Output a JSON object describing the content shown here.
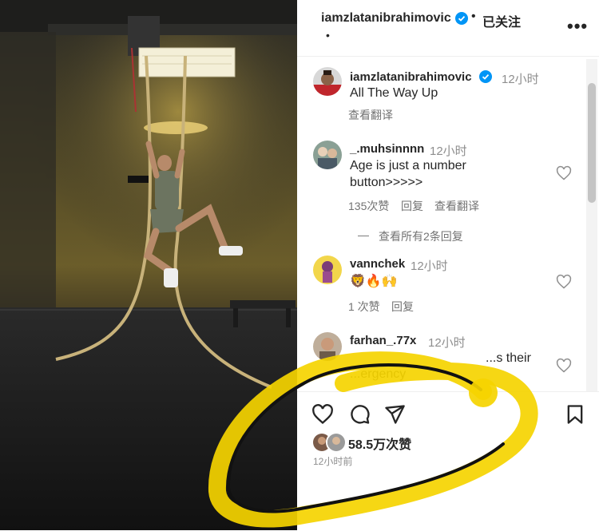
{
  "header": {
    "username": "iamzlatanibrahimovic",
    "separator": "•",
    "follow_status": "已关注",
    "sub_dot": "•",
    "more": "•••"
  },
  "caption": {
    "username": "iamzlatanibrahimovic",
    "time": "12小时",
    "text": "All The Way Up",
    "translate": "查看翻译"
  },
  "comments": [
    {
      "username": "_.muhsinnnn",
      "time": "12小时",
      "line1": "Age is just a number",
      "line2": "button>>>>>",
      "likes": "135次赞",
      "reply": "回复",
      "translate": "查看翻译",
      "view_replies": "查看所有2条回复"
    },
    {
      "username": "vannchek",
      "time": "12小时",
      "line1": "🦁🔥🙌",
      "likes": "1 次赞",
      "reply": "回复"
    },
    {
      "username": "farhan_.77x",
      "time": "12小时",
      "line1": "...s their",
      "line2": "...ergency"
    }
  ],
  "footer": {
    "likes": "58.5万次赞",
    "time_ago": "12小时前"
  },
  "colors": {
    "verified": "#0095f6",
    "highlight": "#f5d400",
    "text": "#262626",
    "muted": "#8e8e8e"
  }
}
